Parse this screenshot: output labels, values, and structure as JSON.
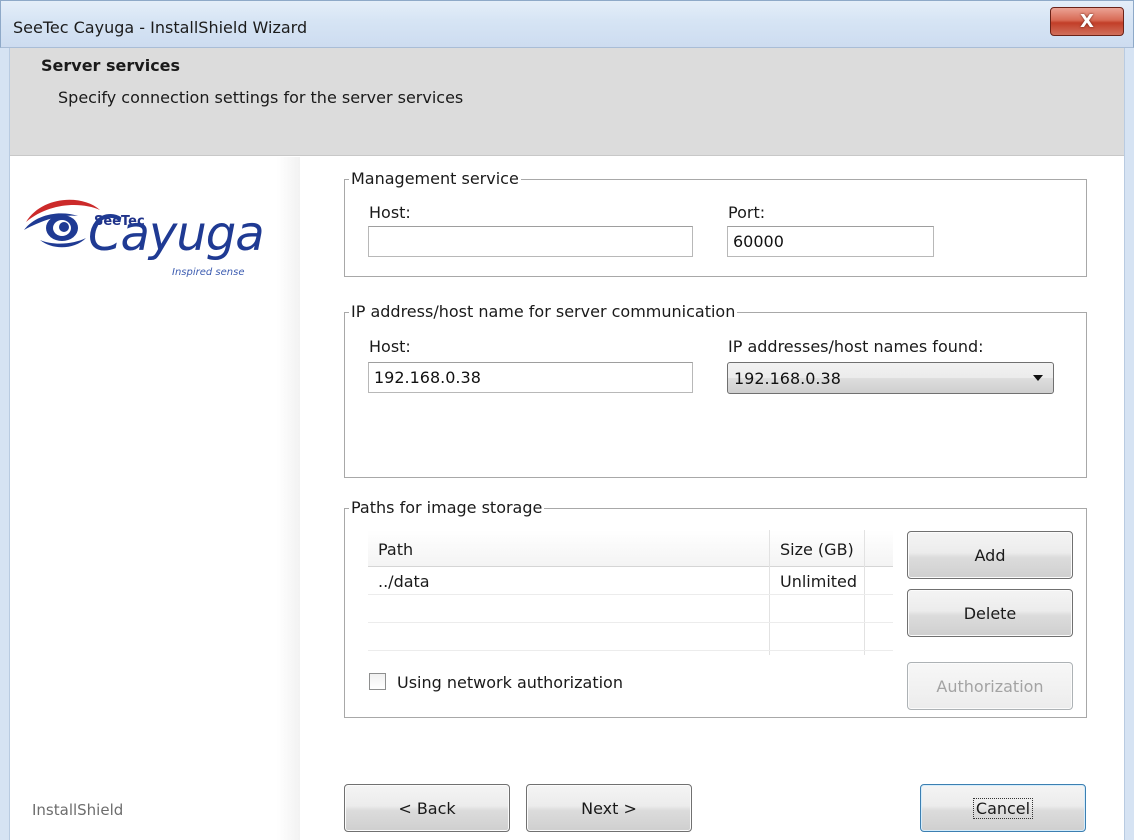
{
  "window": {
    "title": "SeeTec Cayuga - InstallShield Wizard",
    "close_glyph": "X"
  },
  "header": {
    "title": "Server services",
    "subtitle": "Specify connection settings for the server services"
  },
  "logo": {
    "brand": "SeeTec",
    "product": "Cayuga",
    "tagline": "Inspired sense",
    "colors": {
      "eye_red": "#cc2a2a",
      "eye_blue": "#1f3a93"
    }
  },
  "management": {
    "legend": "Management service",
    "host_label": "Host:",
    "host_value": "",
    "port_label": "Port:",
    "port_value": "60000"
  },
  "communication": {
    "legend": "IP address/host name for server communication",
    "host_label": "Host:",
    "host_value": "192.168.0.38",
    "found_label": "IP addresses/host names found:",
    "found_selected": "192.168.0.38"
  },
  "storage": {
    "legend": "Paths for image storage",
    "columns": [
      "Path",
      "Size (GB)"
    ],
    "rows": [
      {
        "path": "../data",
        "size": "Unlimited"
      }
    ],
    "add_label": "Add",
    "delete_label": "Delete",
    "authorization_label": "Authorization",
    "checkbox_label": "Using network authorization",
    "checkbox_checked": false
  },
  "footer": {
    "brand": "InstallShield",
    "back_label": "< Back",
    "next_label": "Next >",
    "cancel_label": "Cancel"
  }
}
